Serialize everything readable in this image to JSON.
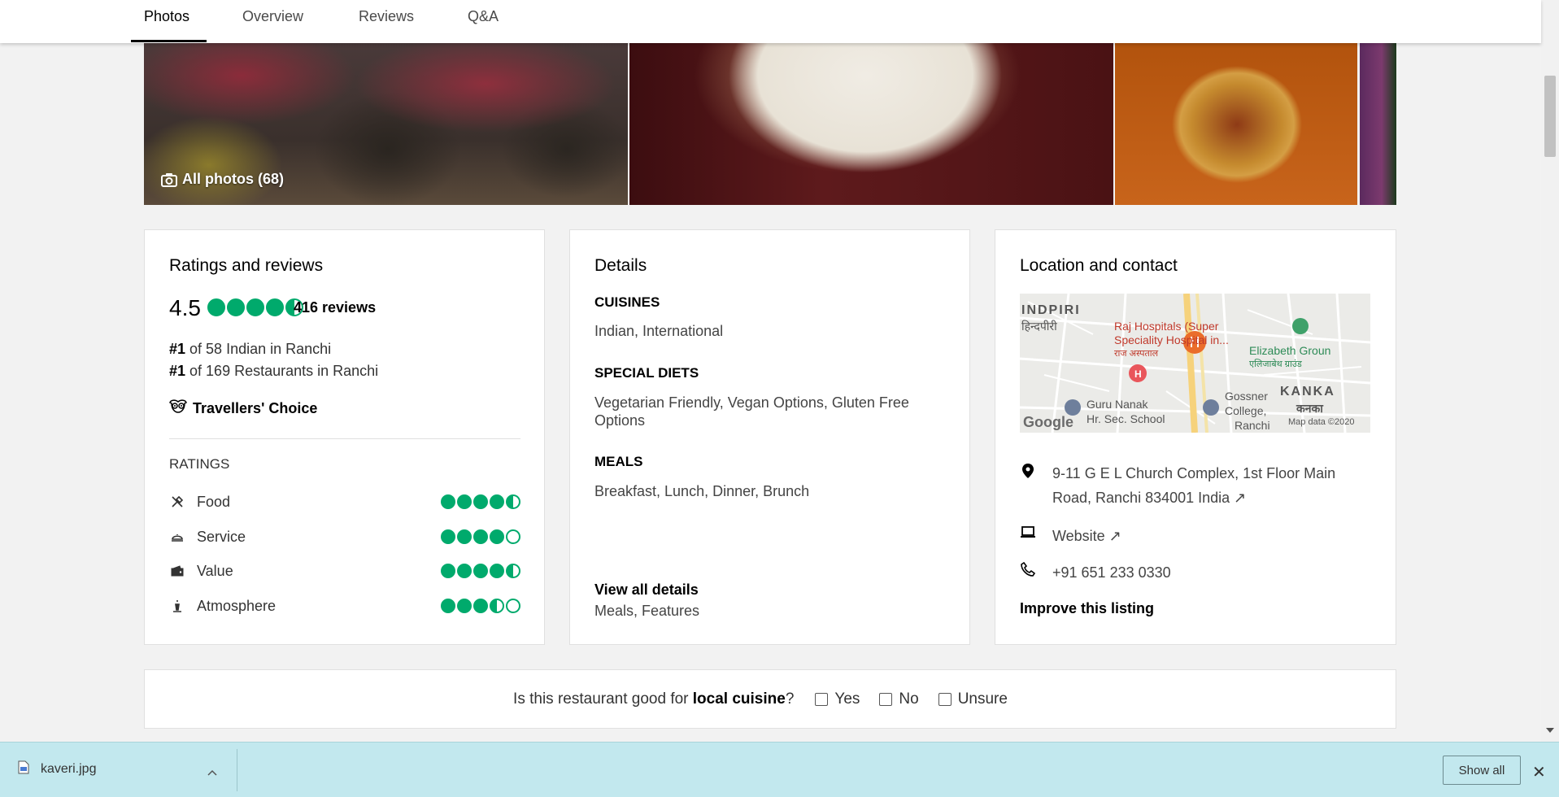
{
  "tabs": [
    {
      "label": "Photos",
      "active": true
    },
    {
      "label": "Overview",
      "active": false
    },
    {
      "label": "Reviews",
      "active": false
    },
    {
      "label": "Q&A",
      "active": false
    }
  ],
  "photos": {
    "all_photos_label": "All photos (68)"
  },
  "ratings_card": {
    "title": "Ratings and reviews",
    "overall_rating": "4.5",
    "overall_bubbles": 4.5,
    "reviews_count": "416 reviews",
    "rank1_prefix": "#1",
    "rank1_text": " of 58 Indian in Ranchi",
    "rank2_prefix": "#1",
    "rank2_text": " of 169 Restaurants in Ranchi",
    "travellers_choice": "Travellers' Choice",
    "ratings_heading": "RATINGS",
    "ratings": [
      {
        "label": "Food",
        "icon": "fork-knife-icon",
        "value": 4.5
      },
      {
        "label": "Service",
        "icon": "service-bell-icon",
        "value": 4.0
      },
      {
        "label": "Value",
        "icon": "wallet-icon",
        "value": 4.5
      },
      {
        "label": "Atmosphere",
        "icon": "atmosphere-icon",
        "value": 3.5
      }
    ]
  },
  "details_card": {
    "title": "Details",
    "cuisines_heading": "CUISINES",
    "cuisines": "Indian, International",
    "diets_heading": "SPECIAL DIETS",
    "diets": "Vegetarian Friendly, Vegan Options, Gluten Free Options",
    "meals_heading": "MEALS",
    "meals": "Breakfast, Lunch, Dinner, Brunch",
    "view_all": "View all details",
    "view_all_sub": "Meals, Features"
  },
  "location_card": {
    "title": "Location and contact",
    "map": {
      "labels": {
        "indpiri": "INDPIRI",
        "indpiri_hi": "हिन्दपीरी",
        "raj": "Raj Hospitals (Super",
        "raj2": "Speciality Hospital in...",
        "raj_hi": "राज अस्पताल",
        "elizabeth": "Elizabeth Groun",
        "elizabeth_hi": "एलिजाबेथ ग्राउंड",
        "guru": "Guru Nanak",
        "guru2": "Hr. Sec. School",
        "gossner": "Gossner",
        "gossner2": "College,",
        "gossner3": "Ranchi",
        "kanka": "KANKA",
        "kanka_hi": "कनका",
        "google": "Google",
        "mapdata": "Map data ©2020"
      }
    },
    "address": "9-11 G E L Church Complex, 1st Floor Main Road, Ranchi 834001 India ↗",
    "website": "Website ↗",
    "phone": "+91 651 233 0330",
    "improve": "Improve this listing"
  },
  "question": {
    "prefix": "Is this restaurant good for ",
    "bold": "local cuisine",
    "suffix": "?",
    "options": [
      "Yes",
      "No",
      "Unsure"
    ]
  },
  "download_bar": {
    "filename": "kaveri.jpg",
    "show_all": "Show all"
  },
  "colors": {
    "bubble_green": "#00aa6c",
    "download_bar_bg": "#c2e8ee"
  }
}
